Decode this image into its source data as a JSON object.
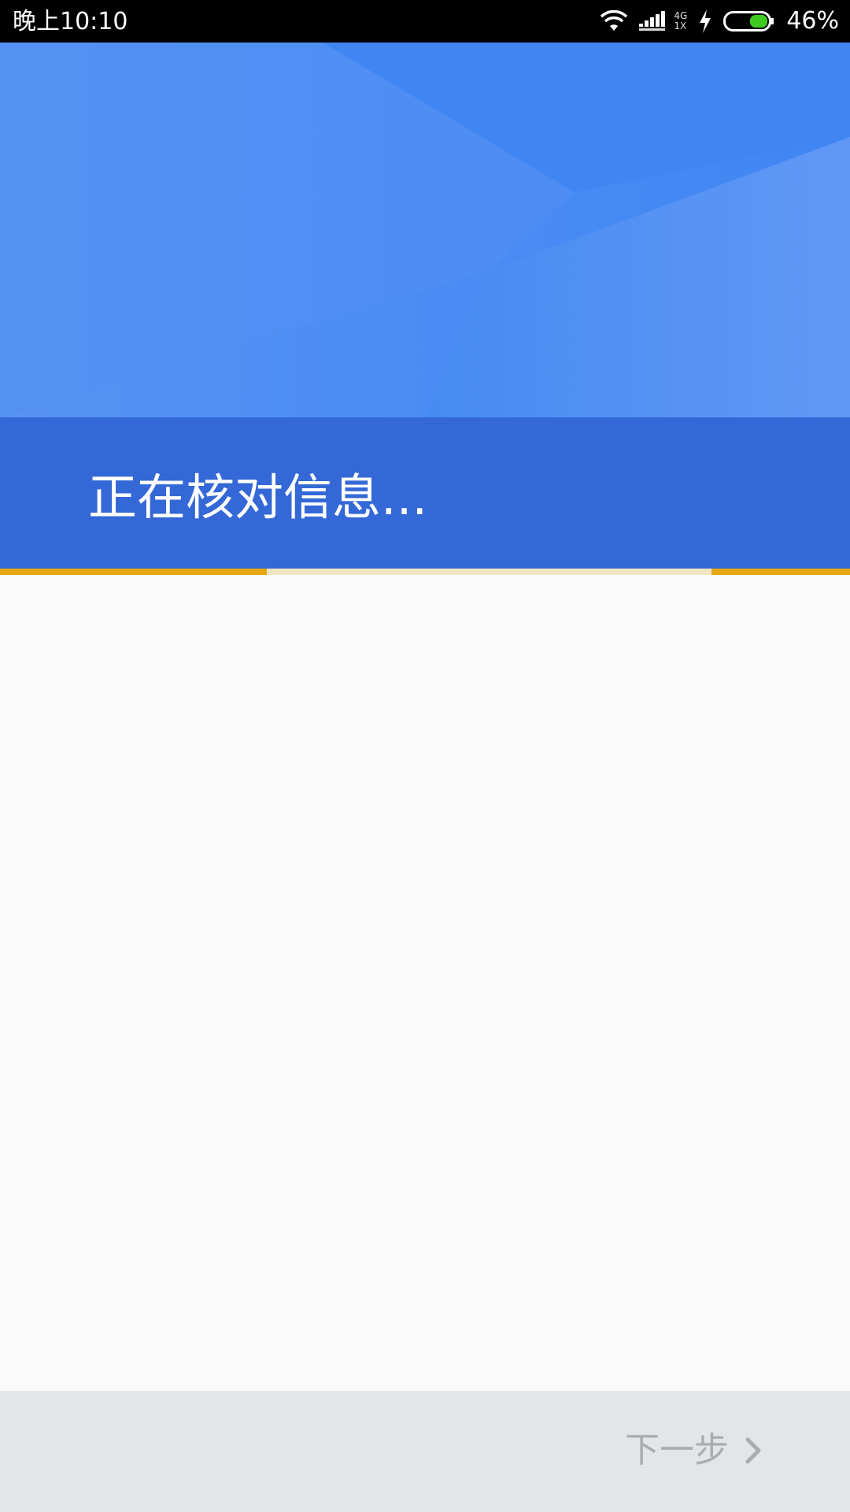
{
  "status_bar": {
    "time": "晚上10:10",
    "network_type_top": "4G",
    "network_type_bottom": "1X",
    "battery_percent": "46%",
    "battery_color": "#3ecb1f",
    "icons": [
      "wifi-icon",
      "signal-icon",
      "charging-icon",
      "battery-icon"
    ]
  },
  "header": {
    "title": "正在核对信息...",
    "background_color": "#4e8df2",
    "band_color": "#3468d6"
  },
  "progress": {
    "accent_color": "#e6a712",
    "track_color": "#f1e5c4"
  },
  "footer": {
    "next_label": "下一步",
    "next_icon": "chevron-right-icon",
    "disabled_color": "#a9acb0"
  }
}
